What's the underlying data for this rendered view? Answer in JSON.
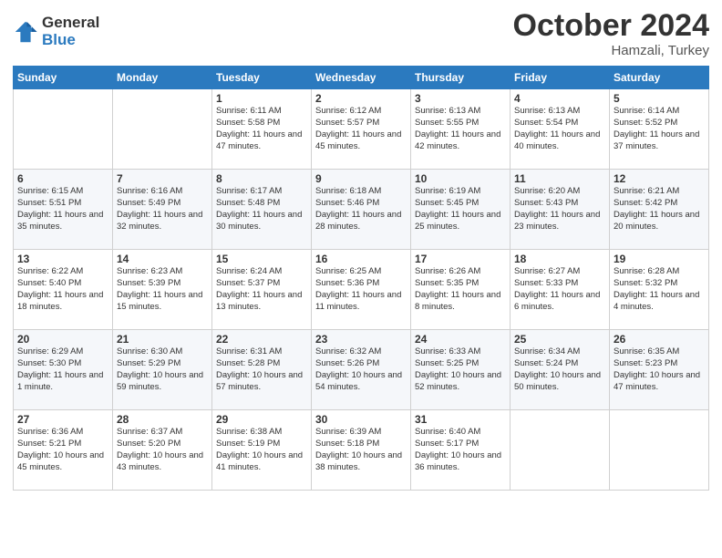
{
  "logo": {
    "general": "General",
    "blue": "Blue"
  },
  "title": {
    "month_year": "October 2024",
    "location": "Hamzali, Turkey"
  },
  "headers": [
    "Sunday",
    "Monday",
    "Tuesday",
    "Wednesday",
    "Thursday",
    "Friday",
    "Saturday"
  ],
  "weeks": [
    [
      {
        "day": "",
        "content": ""
      },
      {
        "day": "",
        "content": ""
      },
      {
        "day": "1",
        "content": "Sunrise: 6:11 AM\nSunset: 5:58 PM\nDaylight: 11 hours and 47 minutes."
      },
      {
        "day": "2",
        "content": "Sunrise: 6:12 AM\nSunset: 5:57 PM\nDaylight: 11 hours and 45 minutes."
      },
      {
        "day": "3",
        "content": "Sunrise: 6:13 AM\nSunset: 5:55 PM\nDaylight: 11 hours and 42 minutes."
      },
      {
        "day": "4",
        "content": "Sunrise: 6:13 AM\nSunset: 5:54 PM\nDaylight: 11 hours and 40 minutes."
      },
      {
        "day": "5",
        "content": "Sunrise: 6:14 AM\nSunset: 5:52 PM\nDaylight: 11 hours and 37 minutes."
      }
    ],
    [
      {
        "day": "6",
        "content": "Sunrise: 6:15 AM\nSunset: 5:51 PM\nDaylight: 11 hours and 35 minutes."
      },
      {
        "day": "7",
        "content": "Sunrise: 6:16 AM\nSunset: 5:49 PM\nDaylight: 11 hours and 32 minutes."
      },
      {
        "day": "8",
        "content": "Sunrise: 6:17 AM\nSunset: 5:48 PM\nDaylight: 11 hours and 30 minutes."
      },
      {
        "day": "9",
        "content": "Sunrise: 6:18 AM\nSunset: 5:46 PM\nDaylight: 11 hours and 28 minutes."
      },
      {
        "day": "10",
        "content": "Sunrise: 6:19 AM\nSunset: 5:45 PM\nDaylight: 11 hours and 25 minutes."
      },
      {
        "day": "11",
        "content": "Sunrise: 6:20 AM\nSunset: 5:43 PM\nDaylight: 11 hours and 23 minutes."
      },
      {
        "day": "12",
        "content": "Sunrise: 6:21 AM\nSunset: 5:42 PM\nDaylight: 11 hours and 20 minutes."
      }
    ],
    [
      {
        "day": "13",
        "content": "Sunrise: 6:22 AM\nSunset: 5:40 PM\nDaylight: 11 hours and 18 minutes."
      },
      {
        "day": "14",
        "content": "Sunrise: 6:23 AM\nSunset: 5:39 PM\nDaylight: 11 hours and 15 minutes."
      },
      {
        "day": "15",
        "content": "Sunrise: 6:24 AM\nSunset: 5:37 PM\nDaylight: 11 hours and 13 minutes."
      },
      {
        "day": "16",
        "content": "Sunrise: 6:25 AM\nSunset: 5:36 PM\nDaylight: 11 hours and 11 minutes."
      },
      {
        "day": "17",
        "content": "Sunrise: 6:26 AM\nSunset: 5:35 PM\nDaylight: 11 hours and 8 minutes."
      },
      {
        "day": "18",
        "content": "Sunrise: 6:27 AM\nSunset: 5:33 PM\nDaylight: 11 hours and 6 minutes."
      },
      {
        "day": "19",
        "content": "Sunrise: 6:28 AM\nSunset: 5:32 PM\nDaylight: 11 hours and 4 minutes."
      }
    ],
    [
      {
        "day": "20",
        "content": "Sunrise: 6:29 AM\nSunset: 5:30 PM\nDaylight: 11 hours and 1 minute."
      },
      {
        "day": "21",
        "content": "Sunrise: 6:30 AM\nSunset: 5:29 PM\nDaylight: 10 hours and 59 minutes."
      },
      {
        "day": "22",
        "content": "Sunrise: 6:31 AM\nSunset: 5:28 PM\nDaylight: 10 hours and 57 minutes."
      },
      {
        "day": "23",
        "content": "Sunrise: 6:32 AM\nSunset: 5:26 PM\nDaylight: 10 hours and 54 minutes."
      },
      {
        "day": "24",
        "content": "Sunrise: 6:33 AM\nSunset: 5:25 PM\nDaylight: 10 hours and 52 minutes."
      },
      {
        "day": "25",
        "content": "Sunrise: 6:34 AM\nSunset: 5:24 PM\nDaylight: 10 hours and 50 minutes."
      },
      {
        "day": "26",
        "content": "Sunrise: 6:35 AM\nSunset: 5:23 PM\nDaylight: 10 hours and 47 minutes."
      }
    ],
    [
      {
        "day": "27",
        "content": "Sunrise: 6:36 AM\nSunset: 5:21 PM\nDaylight: 10 hours and 45 minutes."
      },
      {
        "day": "28",
        "content": "Sunrise: 6:37 AM\nSunset: 5:20 PM\nDaylight: 10 hours and 43 minutes."
      },
      {
        "day": "29",
        "content": "Sunrise: 6:38 AM\nSunset: 5:19 PM\nDaylight: 10 hours and 41 minutes."
      },
      {
        "day": "30",
        "content": "Sunrise: 6:39 AM\nSunset: 5:18 PM\nDaylight: 10 hours and 38 minutes."
      },
      {
        "day": "31",
        "content": "Sunrise: 6:40 AM\nSunset: 5:17 PM\nDaylight: 10 hours and 36 minutes."
      },
      {
        "day": "",
        "content": ""
      },
      {
        "day": "",
        "content": ""
      }
    ]
  ]
}
